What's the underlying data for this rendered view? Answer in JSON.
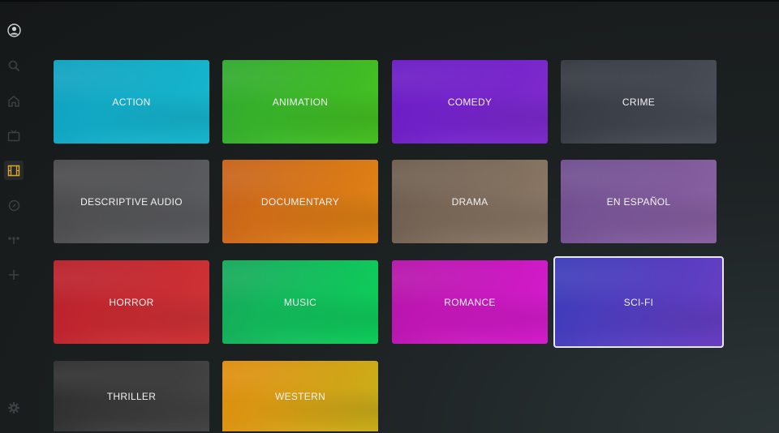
{
  "sidebar": {
    "items": [
      {
        "icon": "profile-icon"
      },
      {
        "icon": "search-icon"
      },
      {
        "icon": "home-icon"
      },
      {
        "icon": "tv-icon"
      },
      {
        "icon": "movies-icon",
        "active": true
      },
      {
        "icon": "discover-icon"
      },
      {
        "icon": "sports-icon"
      },
      {
        "icon": "add-icon"
      },
      {
        "icon": "settings-icon"
      }
    ]
  },
  "genres": [
    {
      "label": "ACTION",
      "color_start": "#0fa1c0",
      "color_end": "#17b8cf"
    },
    {
      "label": "ANIMATION",
      "color_start": "#2fa92f",
      "color_end": "#47c221"
    },
    {
      "label": "COMEDY",
      "color_start": "#6a1cc4",
      "color_end": "#7f2bcf"
    },
    {
      "label": "CRIME",
      "color_start": "#33373e",
      "color_end": "#4b505a"
    },
    {
      "label": "DESCRIPTIVE AUDIO",
      "color_start": "#4a4a4c",
      "color_end": "#5d5e61"
    },
    {
      "label": "DOCUMENTARY",
      "color_start": "#c7611a",
      "color_end": "#e18514"
    },
    {
      "label": "DRAMA",
      "color_start": "#6c5c4d",
      "color_end": "#8d7a68"
    },
    {
      "label": "EN ESPAÑOL",
      "color_start": "#6e4d8e",
      "color_end": "#8a62a3"
    },
    {
      "label": "HORROR",
      "color_start": "#b8202b",
      "color_end": "#d13437"
    },
    {
      "label": "MUSIC",
      "color_start": "#15a85a",
      "color_end": "#0ed05b"
    },
    {
      "label": "ROMANCE",
      "color_start": "#b514a8",
      "color_end": "#d61ccf"
    },
    {
      "label": "SCI-FI",
      "color_start": "#3b3cb8",
      "color_end": "#6a3ec5",
      "focused": true
    },
    {
      "label": "THRILLER",
      "color_start": "#2e2e2f",
      "color_end": "#454546"
    },
    {
      "label": "WESTERN",
      "color_start": "#e08c0f",
      "color_end": "#c9b01a"
    }
  ]
}
